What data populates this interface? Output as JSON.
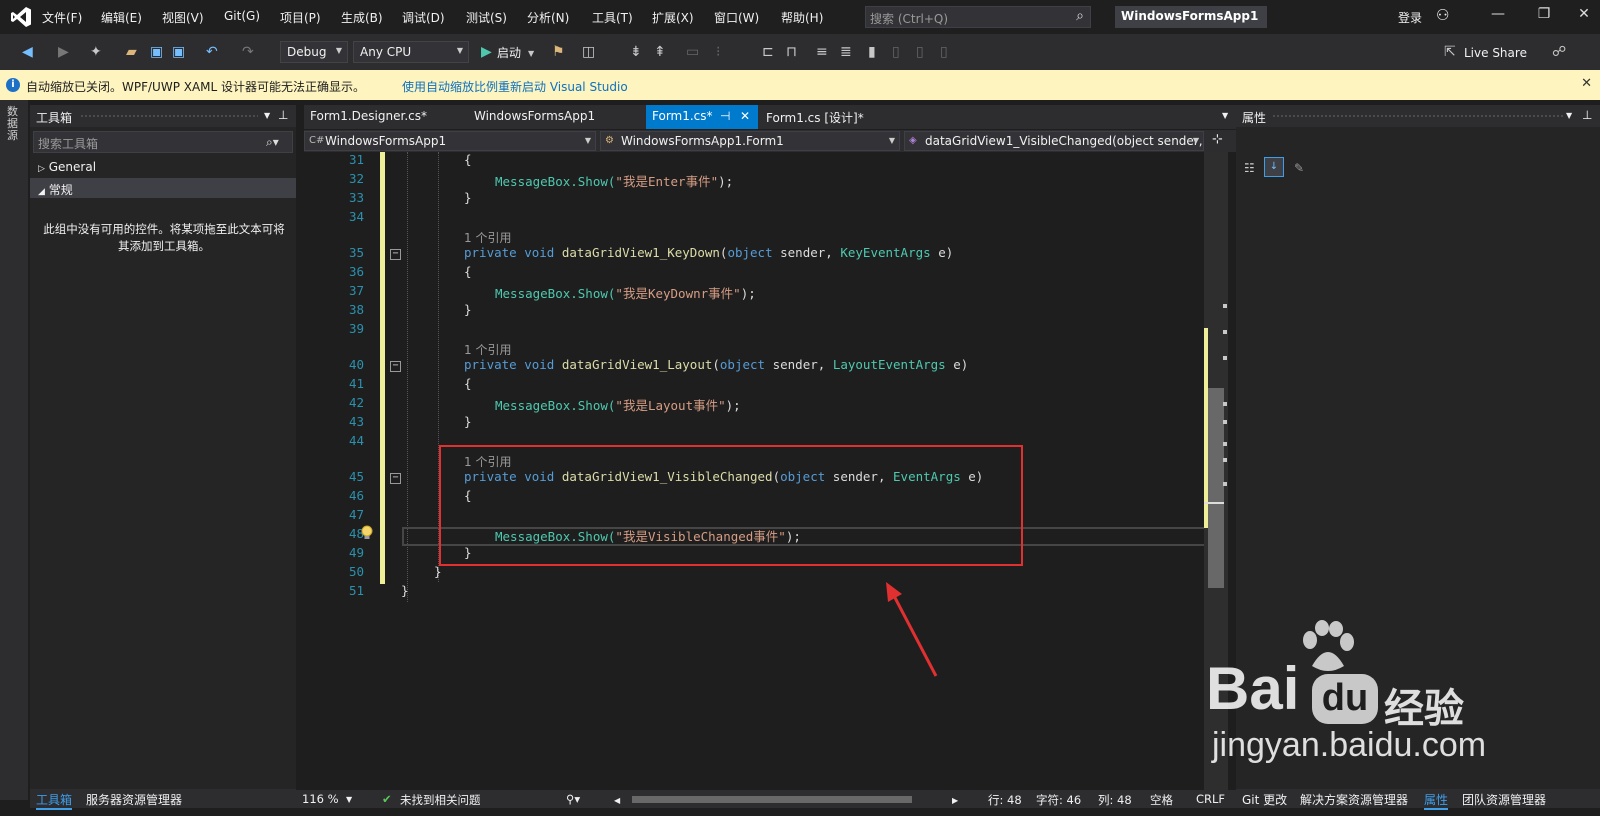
{
  "menu": {
    "items": [
      "文件(F)",
      "编辑(E)",
      "视图(V)",
      "Git(G)",
      "项目(P)",
      "生成(B)",
      "调试(D)",
      "测试(S)",
      "分析(N)",
      "工具(T)",
      "扩展(X)",
      "窗口(W)",
      "帮助(H)"
    ],
    "search_placeholder": "搜索 (Ctrl+Q)",
    "solution_name": "WindowsFormsApp1",
    "login": "登录"
  },
  "toolbar": {
    "config": "Debug",
    "platform": "Any CPU",
    "start_label": "启动",
    "live_share": "Live Share"
  },
  "infobar": {
    "message": "自动缩放已关闭。WPF/UWP XAML 设计器可能无法正确显示。",
    "link": "使用自动缩放比例重新启动 Visual Studio"
  },
  "left_strip": {
    "label": "数据源"
  },
  "toolbox": {
    "title": "工具箱",
    "search_placeholder": "搜索工具箱",
    "groups": [
      "General",
      "常规"
    ],
    "empty_text": "此组中没有可用的控件。将某项拖至此文本可将其添加到工具箱。",
    "bottom_tabs": [
      "工具箱",
      "服务器资源管理器"
    ]
  },
  "doc_tabs": [
    "Form1.Designer.cs*",
    "WindowsFormsApp1",
    "Form1.cs*",
    "Form1.cs [设计]*"
  ],
  "navbar": {
    "project": "WindowsFormsApp1",
    "class": "WindowsFormsApp1.Form1",
    "member": "dataGridView1_VisibleChanged(object sender, EventArgs e)"
  },
  "editor": {
    "ref_text": "1 个引用",
    "lines": [
      {
        "n": "31",
        "kind": "brace",
        "text": "{"
      },
      {
        "n": "32",
        "kind": "msg",
        "text": "\"我是Enter事件\""
      },
      {
        "n": "33",
        "kind": "brace",
        "text": "}"
      },
      {
        "n": "34",
        "kind": "empty",
        "text": ""
      },
      {
        "n": "35",
        "kind": "sig",
        "name": "dataGridView1_KeyDown",
        "argtype": "KeyEventArgs"
      },
      {
        "n": "36",
        "kind": "brace",
        "text": "{"
      },
      {
        "n": "37",
        "kind": "msg",
        "text": "\"我是KeyDownr事件\""
      },
      {
        "n": "38",
        "kind": "brace",
        "text": "}"
      },
      {
        "n": "39",
        "kind": "empty",
        "text": ""
      },
      {
        "n": "40",
        "kind": "sig",
        "name": "dataGridView1_Layout",
        "argtype": "LayoutEventArgs"
      },
      {
        "n": "41",
        "kind": "brace",
        "text": "{"
      },
      {
        "n": "42",
        "kind": "msg",
        "text": "\"我是Layout事件\""
      },
      {
        "n": "43",
        "kind": "brace",
        "text": "}"
      },
      {
        "n": "44",
        "kind": "empty",
        "text": ""
      },
      {
        "n": "45",
        "kind": "sig",
        "name": "dataGridView1_VisibleChanged",
        "argtype": "EventArgs"
      },
      {
        "n": "46",
        "kind": "brace",
        "text": "{"
      },
      {
        "n": "47",
        "kind": "empty",
        "text": ""
      },
      {
        "n": "48",
        "kind": "msg",
        "text": "\"我是VisibleChanged事件\""
      },
      {
        "n": "49",
        "kind": "brace",
        "text": "}"
      },
      {
        "n": "50",
        "kind": "brace",
        "text": "}"
      },
      {
        "n": "51",
        "kind": "brace",
        "text": "}"
      }
    ],
    "msg_prefix": "MessageBox.Show(",
    "msg_suffix": ");",
    "kw_private": "private",
    "kw_void": "void",
    "kw_object": "object",
    "param_sender": "sender",
    "param_e": "e)"
  },
  "properties": {
    "title": "属性",
    "bottom_tabs": [
      "Git 更改",
      "解决方案资源管理器",
      "属性",
      "团队资源管理器"
    ]
  },
  "status": {
    "zoom": "116 %",
    "issues": "未找到相关问题",
    "line": "行: 48",
    "char": "字符: 46",
    "col": "列: 48",
    "indent": "空格",
    "eol": "CRLF"
  },
  "watermark": {
    "brand": "Bai",
    "brand2": "du",
    "product": "经验",
    "url": "jingyan.baidu.com"
  },
  "colors": {
    "accent": "#007acc",
    "highlight_box": "#e03030",
    "info_bg": "#fdf4bf"
  }
}
